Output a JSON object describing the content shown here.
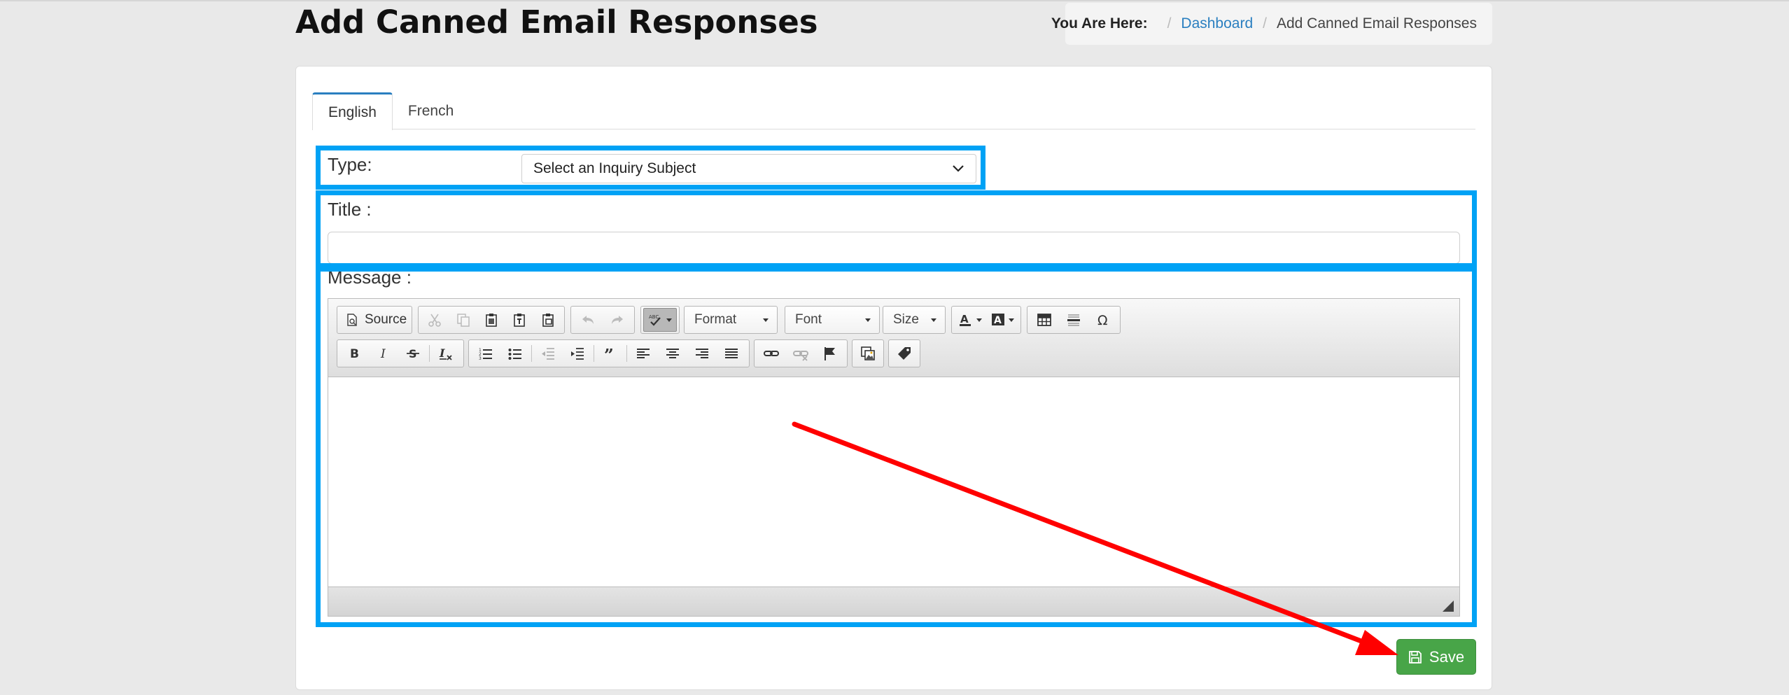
{
  "header": {
    "title": "Add Canned Email Responses",
    "breadcrumb": {
      "lead": "You Are Here:",
      "items": [
        "Dashboard",
        "Add Canned Email Responses"
      ]
    }
  },
  "tabs": [
    {
      "label": "English",
      "active": true
    },
    {
      "label": "French",
      "active": false
    }
  ],
  "form": {
    "type_label": "Type:",
    "type_select_value": "Select an Inquiry Subject",
    "title_label": "Title :",
    "title_value": "",
    "message_label": "Message :"
  },
  "editor": {
    "source_label": "Source",
    "format_label": "Format",
    "font_label": "Font",
    "size_label": "Size"
  },
  "actions": {
    "save_label": "Save"
  },
  "colors": {
    "highlight": "#00a2f5",
    "arrow": "#ff0000",
    "save": "#48a548",
    "link": "#2a7fc0"
  }
}
